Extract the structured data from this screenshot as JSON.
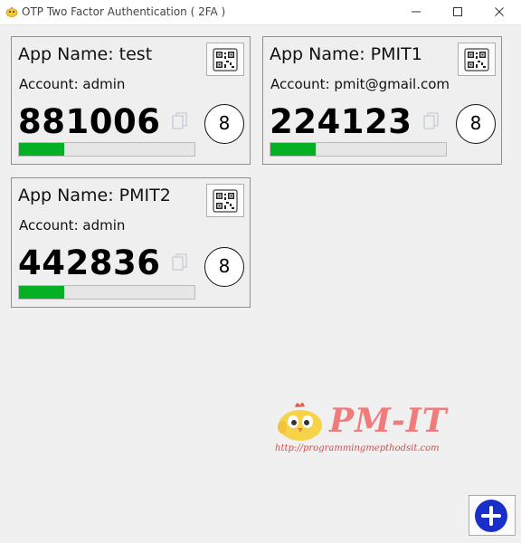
{
  "window": {
    "title": "OTP Two Factor Authentication ( 2FA )",
    "controls": [
      "minimize-icon",
      "maximize-icon",
      "close-icon"
    ]
  },
  "cards": [
    {
      "app_name": "App Name: test",
      "account": "Account: admin",
      "code": "881006",
      "seconds_left": "8",
      "progress_fraction": 0.26,
      "qr_icon": "qr-code-icon",
      "copy_icon": "copy-icon"
    },
    {
      "app_name": "App Name: PMIT1",
      "account": "Account: pmit@gmail.com",
      "code": "224123",
      "seconds_left": "8",
      "progress_fraction": 0.26,
      "qr_icon": "qr-code-icon",
      "copy_icon": "copy-icon"
    },
    {
      "app_name": "App Name: PMIT2",
      "account": "Account: admin",
      "code": "442836",
      "seconds_left": "8",
      "progress_fraction": 0.26,
      "qr_icon": "qr-code-icon",
      "copy_icon": "copy-icon"
    }
  ],
  "watermark": {
    "logo_text": "PM-IT",
    "url": "http://programmingmepthodsit.com"
  },
  "add_button": {
    "icon": "plus-icon"
  },
  "colors": {
    "progress_fill": "#06b025",
    "add_button": "#1a2fc9",
    "watermark": "#f07b7b"
  }
}
